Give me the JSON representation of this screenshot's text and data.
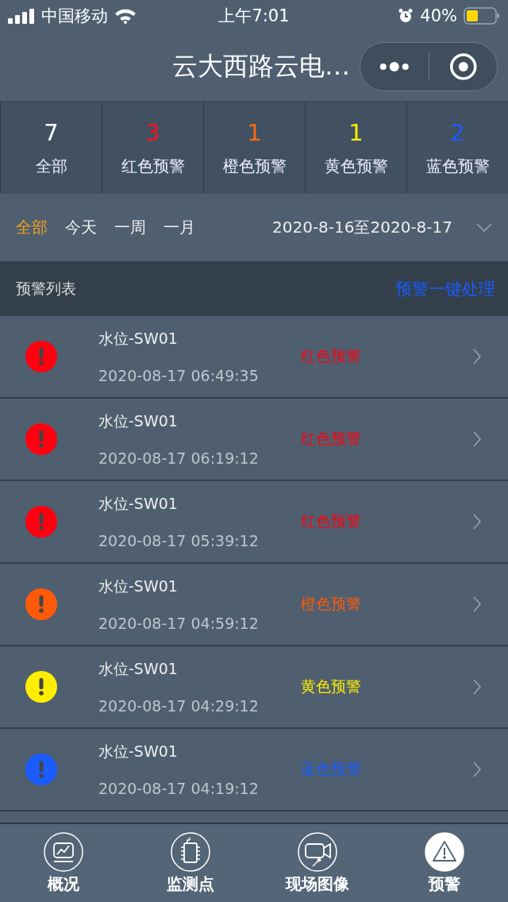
{
  "status_bar": {
    "carrier": "中国移动",
    "time": "上午7:01",
    "battery": "40%"
  },
  "nav": {
    "title": "云大西路云电…"
  },
  "stats": [
    {
      "count": "7",
      "label": "全部",
      "color": "#ffffff"
    },
    {
      "count": "3",
      "label": "红色预警",
      "color": "#ff1020"
    },
    {
      "count": "1",
      "label": "橙色预警",
      "color": "#ff6a10"
    },
    {
      "count": "1",
      "label": "黄色预警",
      "color": "#ffee00"
    },
    {
      "count": "2",
      "label": "蓝色预警",
      "color": "#1a5cff"
    }
  ],
  "filters": [
    {
      "label": "全部",
      "selected": true
    },
    {
      "label": "今天",
      "selected": false
    },
    {
      "label": "一周",
      "selected": false
    },
    {
      "label": "一月",
      "selected": false
    }
  ],
  "date_range": "2020-8-16至2020-8-17",
  "list_header": {
    "title": "预警列表",
    "action": "预警一键处理"
  },
  "alerts": [
    {
      "name": "水位-SW01",
      "time": "2020-08-17 06:49:35",
      "level_label": "红色预警",
      "color": "#ff0010"
    },
    {
      "name": "水位-SW01",
      "time": "2020-08-17 06:19:12",
      "level_label": "红色预警",
      "color": "#ff0010"
    },
    {
      "name": "水位-SW01",
      "time": "2020-08-17 05:39:12",
      "level_label": "红色预警",
      "color": "#ff0010"
    },
    {
      "name": "水位-SW01",
      "time": "2020-08-17 04:59:12",
      "level_label": "橙色预警",
      "color": "#ff5a0a"
    },
    {
      "name": "水位-SW01",
      "time": "2020-08-17 04:29:12",
      "level_label": "黄色预警",
      "color": "#ffee00"
    },
    {
      "name": "水位-SW01",
      "time": "2020-08-17 04:19:12",
      "level_label": "蓝色预警",
      "color": "#1a5cff"
    }
  ],
  "tabs": [
    {
      "kind": "chart",
      "label": "概况",
      "selected": false
    },
    {
      "kind": "device",
      "label": "监测点",
      "selected": false
    },
    {
      "kind": "camera",
      "label": "现场图像",
      "selected": false
    },
    {
      "kind": "warning",
      "label": "预警",
      "selected": true
    }
  ]
}
